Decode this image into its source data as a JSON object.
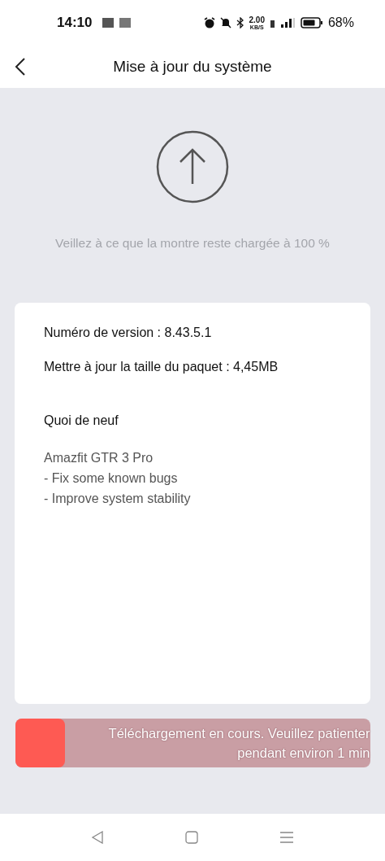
{
  "status_bar": {
    "time": "14:10",
    "speed": "2.00",
    "speed_unit": "KB/S",
    "battery": "68%"
  },
  "header": {
    "title": "Mise à jour du système"
  },
  "hint": "Veillez à ce que la montre reste chargée à 100 %",
  "card": {
    "lines": [
      "Numéro de version : 8.43.5.1",
      "Mettre à jour la taille du paquet : 4,45MB"
    ],
    "whats_new_title": "Quoi de neuf",
    "notes": [
      "Amazfit GTR 3 Pro",
      "- Fix some known bugs",
      "- Improve system stability"
    ]
  },
  "progress": {
    "level": 0.14,
    "text": "Téléchargement en cours. Veuillez patienter pendant environ 1 min"
  }
}
